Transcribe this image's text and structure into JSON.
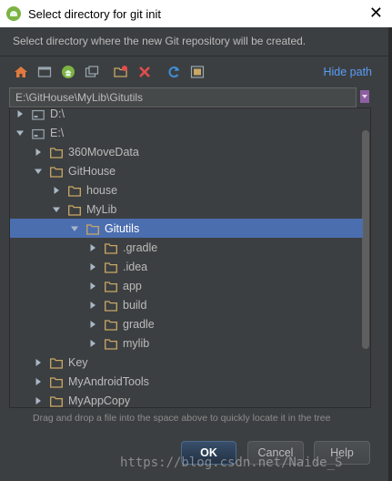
{
  "window": {
    "title": "Select directory for git init",
    "close_glyph": "✕"
  },
  "description": "Select directory where the new Git repository will be created.",
  "toolbar": {
    "buttons": [
      {
        "icon": "home-icon"
      },
      {
        "icon": "desktop-icon"
      },
      {
        "icon": "android-project-icon"
      },
      {
        "icon": "module-icon"
      },
      {
        "icon": "new-folder-icon"
      },
      {
        "icon": "delete-icon"
      },
      {
        "icon": "refresh-icon"
      },
      {
        "icon": "show-hidden-icon"
      }
    ],
    "hide_path_label": "Hide path"
  },
  "path": {
    "value": "E:\\GitHouse\\MyLib\\Gitutils"
  },
  "tree": {
    "rows": [
      {
        "label": "D:\\",
        "level": 0,
        "expanded": false,
        "drive": true,
        "selected": false
      },
      {
        "label": "E:\\",
        "level": 0,
        "expanded": true,
        "drive": true,
        "selected": false
      },
      {
        "label": "360MoveData",
        "level": 1,
        "expanded": false,
        "selected": false
      },
      {
        "label": "GitHouse",
        "level": 1,
        "expanded": true,
        "selected": false
      },
      {
        "label": "house",
        "level": 2,
        "expanded": false,
        "selected": false
      },
      {
        "label": "MyLib",
        "level": 2,
        "expanded": true,
        "selected": false
      },
      {
        "label": "Gitutils",
        "level": 3,
        "expanded": true,
        "selected": true
      },
      {
        "label": ".gradle",
        "level": 4,
        "expanded": false,
        "selected": false
      },
      {
        "label": ".idea",
        "level": 4,
        "expanded": false,
        "selected": false
      },
      {
        "label": "app",
        "level": 4,
        "expanded": false,
        "selected": false
      },
      {
        "label": "build",
        "level": 4,
        "expanded": false,
        "selected": false
      },
      {
        "label": "gradle",
        "level": 4,
        "expanded": false,
        "selected": false
      },
      {
        "label": "mylib",
        "level": 4,
        "expanded": false,
        "selected": false
      },
      {
        "label": "Key",
        "level": 1,
        "expanded": false,
        "selected": false
      },
      {
        "label": "MyAndroidTools",
        "level": 1,
        "expanded": false,
        "selected": false
      },
      {
        "label": "MyAppCopy",
        "level": 1,
        "expanded": false,
        "selected": false
      }
    ]
  },
  "hint": "Drag and drop a file into the space above to quickly locate it in the tree",
  "buttons": {
    "ok": "OK",
    "cancel": "Cancel",
    "help": "Help"
  },
  "watermark": "https://blog.csdn.net/Naide_S",
  "colors": {
    "background": "#3c3f41",
    "selection": "#4b6eaf",
    "link": "#589df6",
    "folder": "#c9a865"
  }
}
